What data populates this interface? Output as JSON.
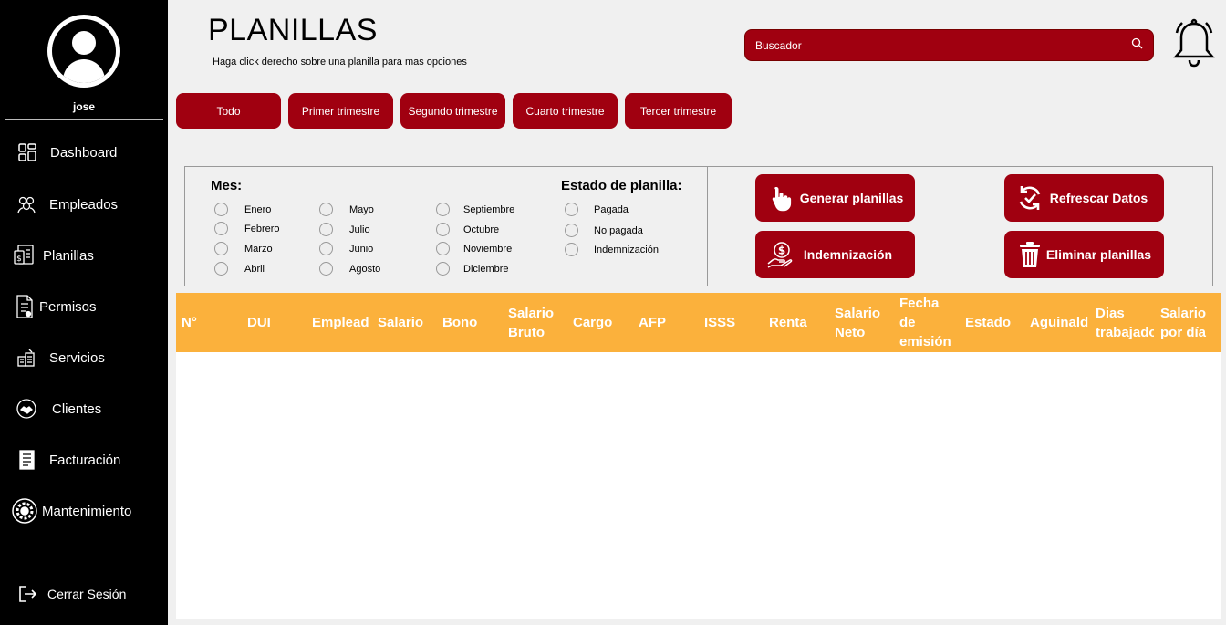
{
  "user": {
    "name": "jose"
  },
  "sidebar": {
    "items": [
      {
        "label": "Dashboard",
        "icon": "dashboard-icon"
      },
      {
        "label": "Empleados",
        "icon": "employees-icon"
      },
      {
        "label": "Planillas",
        "icon": "payroll-icon"
      },
      {
        "label": "Permisos",
        "icon": "permissions-icon"
      },
      {
        "label": "Servicios",
        "icon": "services-icon"
      },
      {
        "label": "Clientes",
        "icon": "clients-icon"
      },
      {
        "label": "Facturación",
        "icon": "invoice-icon"
      },
      {
        "label": "Mantenimiento",
        "icon": "maintenance-icon"
      }
    ],
    "logout": "Cerrar Sesión"
  },
  "header": {
    "title": "PLANILLAS",
    "subtitle": "Haga click derecho sobre una planilla para mas opciones"
  },
  "search": {
    "placeholder": "Buscador"
  },
  "filters": [
    "Todo",
    "Primer trimestre",
    "Segundo trimestre",
    "Cuarto trimestre",
    "Tercer trimestre"
  ],
  "month_group": {
    "title": "Mes:",
    "options": [
      "Enero",
      "Febrero",
      "Marzo",
      "Abril",
      "Mayo",
      "Julio",
      "Junio",
      "Agosto",
      "Septiembre",
      "Octubre",
      "Noviembre",
      "Diciembre"
    ]
  },
  "status_group": {
    "title": "Estado de planilla:",
    "options": [
      "Pagada",
      "No pagada",
      "Indemnización"
    ]
  },
  "actions": {
    "generate": "Generar planillas",
    "refresh": "Refrescar Datos",
    "severance": "Indemnización",
    "delete": "Eliminar planillas"
  },
  "table": {
    "columns": [
      "N°",
      "DUI",
      "Emplead",
      "Salario",
      "Bono",
      "Salario\nBruto",
      "Cargo",
      "AFP",
      "ISSS",
      "Renta",
      "Salario\nNeto",
      "Fecha\nde\nemisión",
      "Estado",
      "Aguinald",
      "Dias\ntrabajado",
      "Salario\npor día"
    ]
  },
  "colors": {
    "sidebar": "#000000",
    "accent": "#a00010",
    "header": "#fbb13c"
  }
}
